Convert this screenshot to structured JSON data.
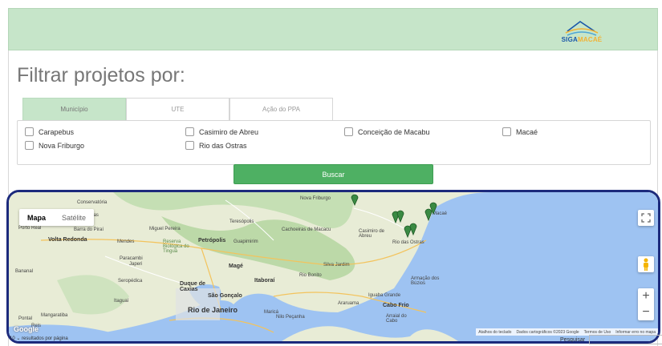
{
  "header": {
    "logo_part1": "SIGA",
    "logo_part2": "MACAÉ"
  },
  "filter": {
    "title": "Filtrar projetos por:",
    "tabs": [
      {
        "label": "Município",
        "active": true
      },
      {
        "label": "UTE",
        "active": false
      },
      {
        "label": "Ação do PPA",
        "active": false
      }
    ],
    "options": [
      "Carapebus",
      "Casimiro de Abreu",
      "Conceição de Macabu",
      "Macaé",
      "Nova Friburgo",
      "Rio das Ostras"
    ],
    "search_button": "Buscar"
  },
  "map": {
    "type_buttons": [
      "Mapa",
      "Satélite"
    ],
    "labels": {
      "conservatoria": "Conservatória",
      "vassouras": "Vassouras",
      "porto_real": "Porto Real",
      "barra_pirai": "Barra do Piraí",
      "miguel_pereira": "Miguel Pereira",
      "teresopolis": "Teresópolis",
      "cachoeiras": "Cachoeiras de Macacu",
      "casimiro": "Casimiro de Abreu",
      "nova_friburgo": "Nova Friburgo",
      "volta_redonda": "Volta Redonda",
      "mendes": "Mendes",
      "reserva": "Reserva Biológica do Tinguá",
      "petropolis": "Petrópolis",
      "guapimirim": "Guapimirim",
      "rio_ostras": "Rio das Ostras",
      "paracambi": "Paracambi",
      "japeri": "Japeri",
      "mage": "Magé",
      "silva_jardim": "Silva Jardim",
      "bananal": "Bananal",
      "seropedica": "Seropédica",
      "duque": "Duque de Caxias",
      "itaborai": "Itaboraí",
      "rio_bonito": "Rio Bonito",
      "armacao": "Armação dos Búzios",
      "sao_goncalo": "São Gonçalo",
      "itaguai": "Itaguaí",
      "iguaba": "Iguaba Grande",
      "araruama": "Araruama",
      "cabo_frio": "Cabo Frio",
      "rio": "Rio de Janeiro",
      "marica": "Maricá",
      "mangaratiba": "Mangaratiba",
      "pontal": "Pontal",
      "reis": "Reis",
      "nilo": "Nilo Peçanha",
      "arraial": "Arraial do Cabo",
      "macae": "Macaé"
    },
    "google": "Google",
    "attribution": [
      "Atalhos do teclado",
      "Dados cartográficos ©2023 Google",
      "Termos de Uso",
      "Informar erro no mapa"
    ],
    "road_numbers": [
      "393",
      "465",
      "116",
      "040",
      "101",
      "493"
    ]
  },
  "table": {
    "page_size_prefix": "10",
    "page_size_label": "resultados por página",
    "search_label": "Pesquisar"
  }
}
